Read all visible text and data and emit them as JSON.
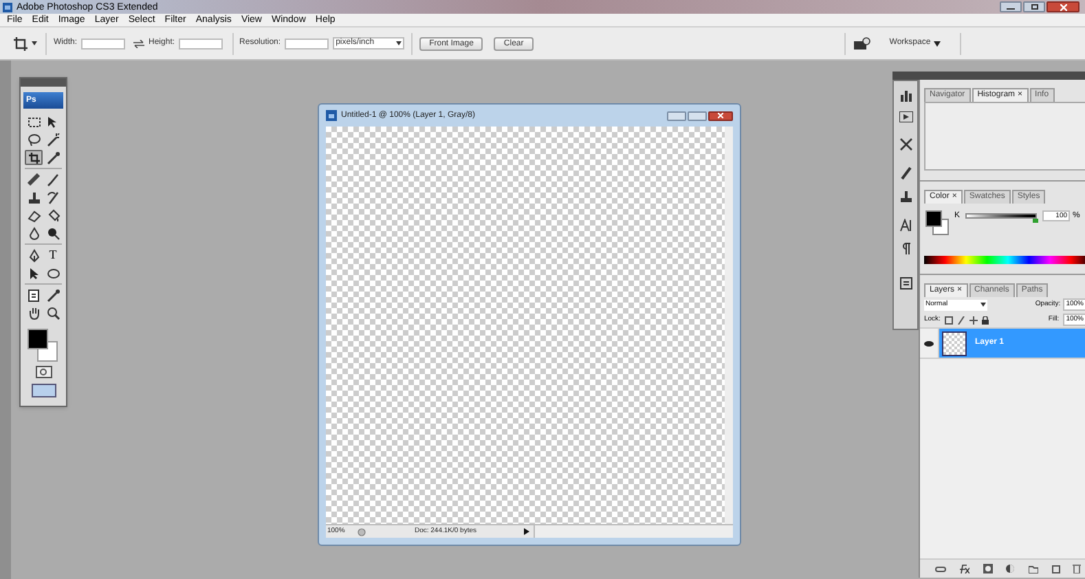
{
  "window": {
    "title": "Adobe Photoshop CS3 Extended"
  },
  "menu": [
    "File",
    "Edit",
    "Image",
    "Layer",
    "Select",
    "Filter",
    "Analysis",
    "View",
    "Window",
    "Help"
  ],
  "options_bar": {
    "width_label": "Width:",
    "height_label": "Height:",
    "resolution_label": "Resolution:",
    "unit": "pixels/inch",
    "buttons": [
      "Front Image",
      "Clear"
    ],
    "workspace": "Workspace"
  },
  "toolbox": {
    "logo": "Ps",
    "tools": [
      {
        "selected": false
      },
      {
        "selected": false
      },
      {
        "selected": false
      },
      {
        "selected": false
      },
      {
        "selected": true
      },
      {
        "selected": false
      },
      {
        "selected": false
      },
      {
        "selected": false
      },
      {
        "selected": false
      },
      {
        "selected": false
      },
      {
        "selected": false
      },
      {
        "selected": false
      },
      {
        "selected": false
      },
      {
        "selected": false
      },
      {
        "selected": false
      },
      {
        "selected": false,
        "glyph": "T"
      },
      {
        "selected": false
      },
      {
        "selected": false
      },
      {
        "selected": false
      },
      {
        "selected": false
      },
      {
        "selected": false
      },
      {
        "selected": false
      }
    ]
  },
  "document": {
    "title": "Untitled-1 @ 100% (Layer 1, Gray/8)",
    "zoom": "100%",
    "doc_info": "Doc: 244.1K/0 bytes"
  },
  "navigator_panel": {
    "tabs": [
      {
        "label": "Navigator",
        "selected": false
      },
      {
        "label": "Histogram",
        "close": "×",
        "selected": true
      },
      {
        "label": "Info",
        "selected": false
      }
    ]
  },
  "color_panel": {
    "tabs": [
      {
        "label": "Color",
        "close": "×",
        "selected": true
      },
      {
        "label": "Swatches",
        "selected": false
      },
      {
        "label": "Styles",
        "selected": false
      }
    ],
    "channel": "K",
    "level": 1,
    "value": "100",
    "unit": "%"
  },
  "layers_panel": {
    "tabs": [
      {
        "label": "Layers",
        "close": "×",
        "selected": true
      },
      {
        "label": "Channels",
        "selected": false
      },
      {
        "label": "Paths",
        "selected": false
      }
    ],
    "blend_mode": "Normal",
    "opacity_label": "Opacity:",
    "opacity": "100%",
    "lock_label": "Lock:",
    "fill_label": "Fill:",
    "fill": "100%",
    "layers": [
      {
        "name": "Layer 1",
        "selected": true,
        "visible": true
      }
    ]
  }
}
